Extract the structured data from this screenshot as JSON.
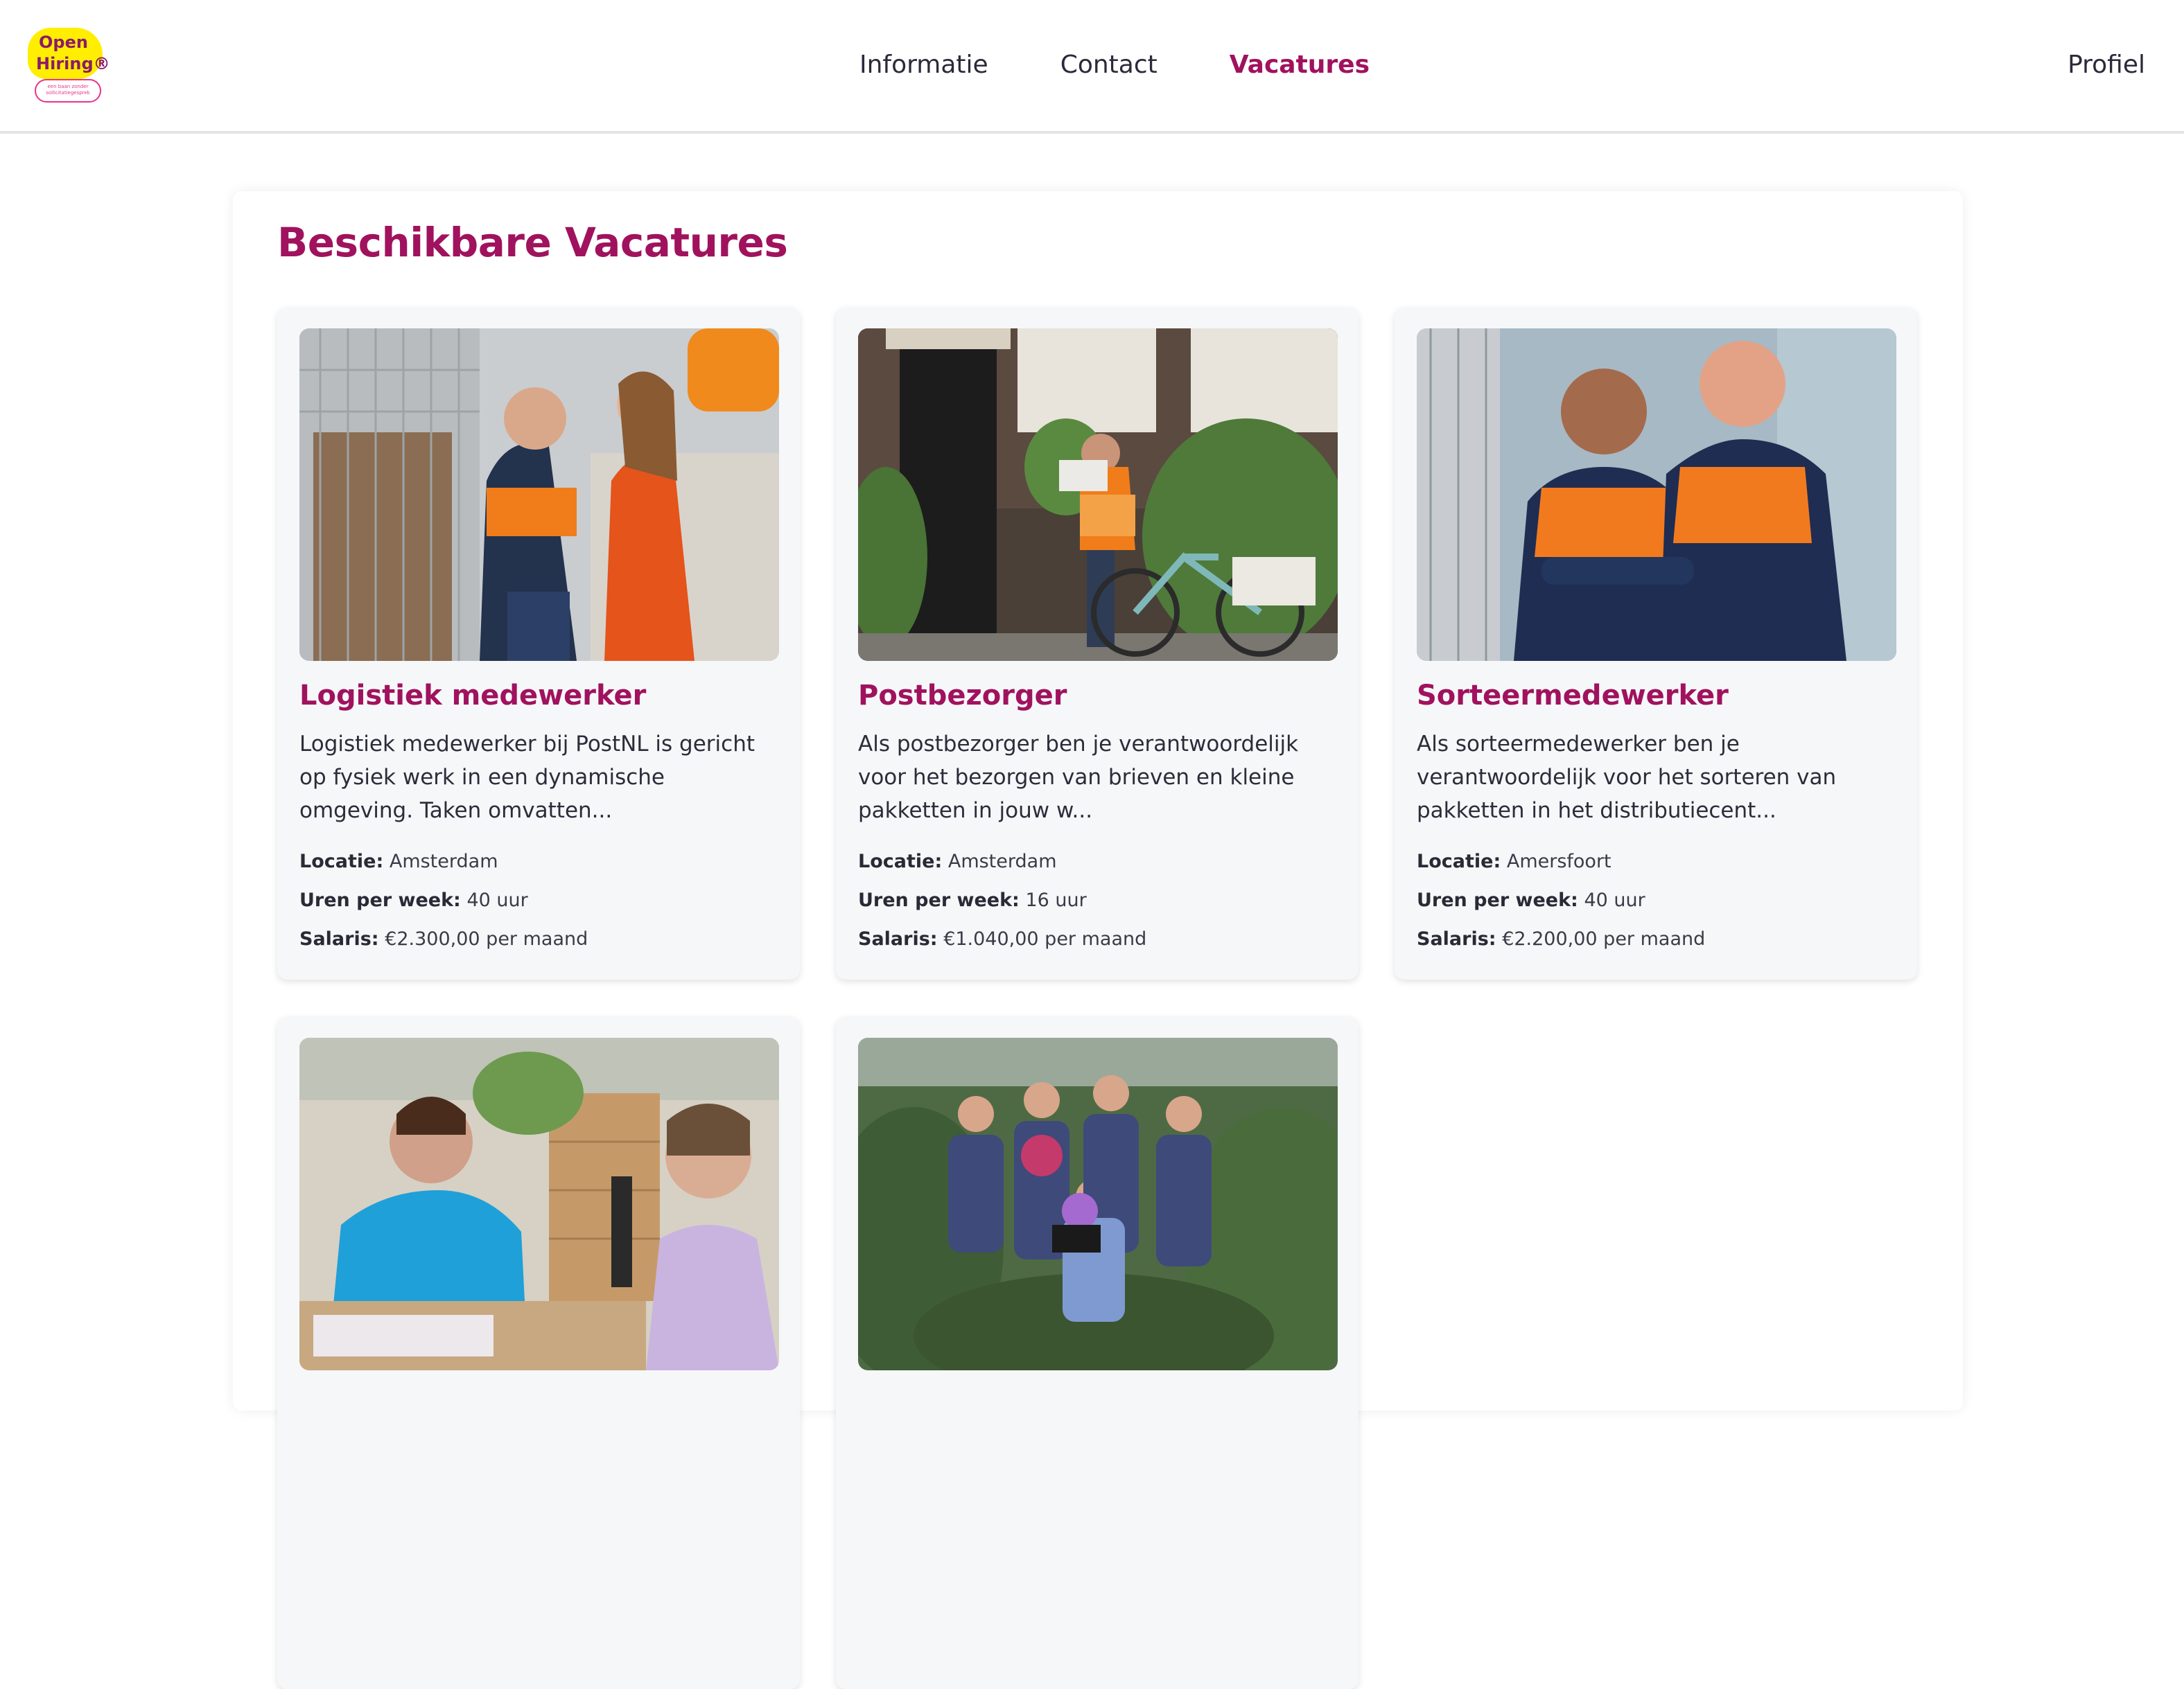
{
  "header": {
    "logo_line1": "Open",
    "logo_line2": "Hiring®",
    "logo_tagline": "een baan zonder sollicitatiegesprek",
    "nav": [
      {
        "label": "Informatie"
      },
      {
        "label": "Contact"
      },
      {
        "label": "Vacatures"
      }
    ],
    "profile_label": "Profiel",
    "accent_color": "#a0125e"
  },
  "main": {
    "title": "Beschikbare Vacatures",
    "labels": {
      "location": "Locatie:",
      "hours": "Uren per week:",
      "salary": "Salaris:"
    },
    "vacancies": [
      {
        "title": "Logistiek medewerker",
        "description": "Logistiek medewerker bij PostNL is gericht op fysiek werk in een dynamische omgeving. Taken omvatten...",
        "location": "Amsterdam",
        "hours": "40 uur",
        "salary": "€2.300,00 per maand",
        "image": "warehouse-workers-photo"
      },
      {
        "title": "Postbezorger",
        "description": "Als postbezorger ben je verantwoordelijk voor het bezorgen van brieven en kleine pakketten in jouw w...",
        "location": "Amsterdam",
        "hours": "16 uur",
        "salary": "€1.040,00 per maand",
        "image": "mail-carrier-bike-photo"
      },
      {
        "title": "Sorteermedewerker",
        "description": "Als sorteermedewerker ben je verantwoordelijk voor het sorteren van pakketten in het distributiecent...",
        "location": "Amersfoort",
        "hours": "40 uur",
        "salary": "€2.200,00 per maand",
        "image": "two-sorters-photo"
      },
      {
        "image": "store-checkout-photo"
      },
      {
        "image": "garden-centre-team-photo"
      }
    ]
  }
}
